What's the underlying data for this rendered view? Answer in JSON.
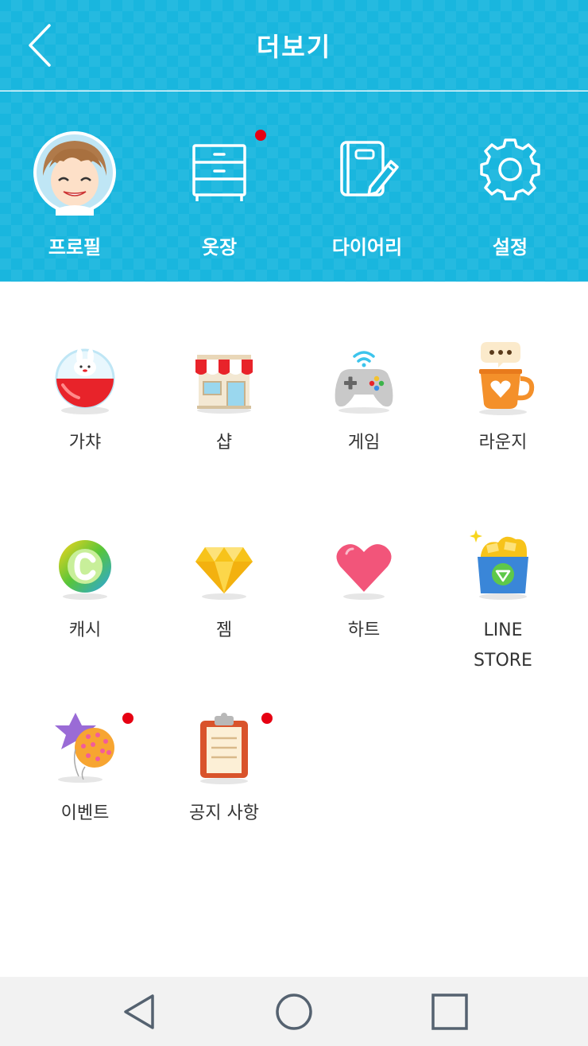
{
  "header": {
    "title": "더보기",
    "back_icon": "chevron-left-icon"
  },
  "quick_menu": [
    {
      "id": "profile",
      "label": "프로필",
      "icon": "avatar-icon"
    },
    {
      "id": "closet",
      "label": "옷장",
      "icon": "drawer-icon",
      "badge": true
    },
    {
      "id": "diary",
      "label": "다이어리",
      "icon": "notebook-pen-icon"
    },
    {
      "id": "settings",
      "label": "설정",
      "icon": "gear-icon"
    }
  ],
  "menu": [
    {
      "id": "gacha",
      "label": "가챠",
      "icon": "gacha-capsule-icon"
    },
    {
      "id": "shop",
      "label": "샵",
      "icon": "storefront-icon"
    },
    {
      "id": "game",
      "label": "게임",
      "icon": "gamepad-icon"
    },
    {
      "id": "lounge",
      "label": "라운지",
      "icon": "coffee-cup-icon"
    },
    {
      "id": "cash",
      "label": "캐시",
      "icon": "coin-c-icon"
    },
    {
      "id": "gem",
      "label": "젬",
      "icon": "diamond-icon"
    },
    {
      "id": "heart",
      "label": "하트",
      "icon": "heart-icon"
    },
    {
      "id": "line-store",
      "label": "LINE\nSTORE",
      "icon": "gold-bucket-icon"
    },
    {
      "id": "event",
      "label": "이벤트",
      "icon": "balloons-icon",
      "badge": true
    },
    {
      "id": "notice",
      "label": "공지 사항",
      "icon": "clipboard-icon",
      "badge": true
    }
  ],
  "colors": {
    "header_bg": "#19b6de",
    "badge": "#e60012",
    "text": "#333333"
  },
  "nav": {
    "back_icon": "triangle-back-icon",
    "home_icon": "circle-home-icon",
    "recents_icon": "square-recents-icon"
  }
}
